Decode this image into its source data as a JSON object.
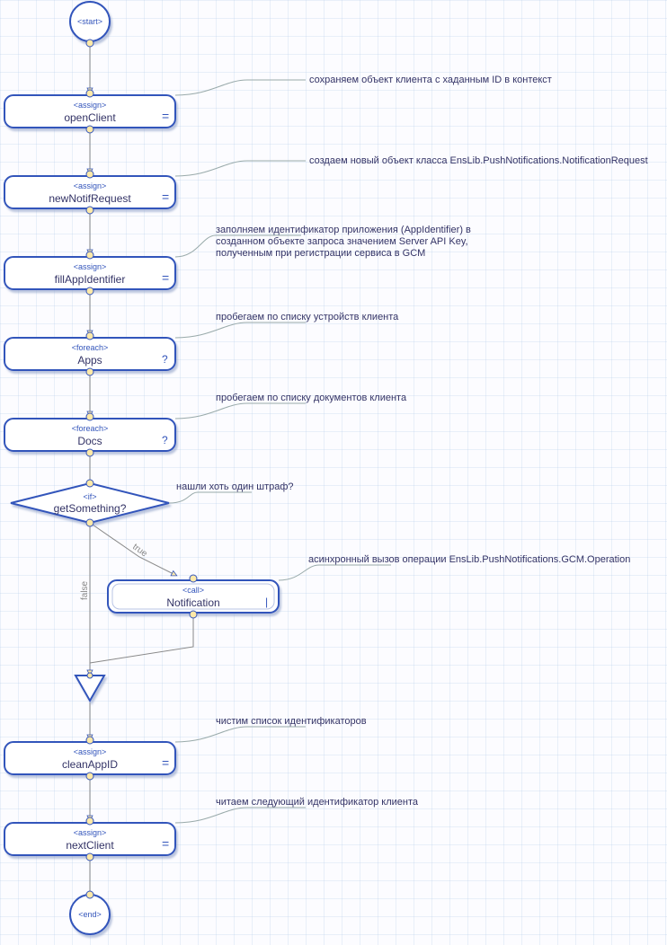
{
  "start": {
    "tag": "<start>"
  },
  "end": {
    "tag": "<end>"
  },
  "nodes": {
    "openClient": {
      "tag": "<assign>",
      "name": "openClient",
      "glyph": "=",
      "comment": "сохраняем объект клиента с хаданным ID в контекст"
    },
    "newNotifRequest": {
      "tag": "<assign>",
      "name": "newNotifRequest",
      "glyph": "=",
      "comment": "создаем новый объект класса EnsLib.PushNotifications.NotificationRequest"
    },
    "fillAppIdentifier": {
      "tag": "<assign>",
      "name": "fillAppIdentifier",
      "glyph": "=",
      "comment_line1": "заполняем идентификатор приложения (AppIdentifier) в",
      "comment_line2": "созданном объекте запроса значением Server API Key,",
      "comment_line3": "полученным при регистрации сервиса в GCM"
    },
    "apps": {
      "tag": "<foreach>",
      "name": "Apps",
      "glyph": "?",
      "comment": "пробегаем по списку устройств клиента"
    },
    "docs": {
      "tag": "<foreach>",
      "name": "Docs",
      "glyph": "?",
      "comment": "пробегаем по списку документов клиента"
    },
    "getSomething": {
      "tag": "<if>",
      "name": "getSomething?",
      "comment": "нашли хоть один штраф?"
    },
    "notification": {
      "tag": "<call>",
      "name": "Notification",
      "glyph": "|",
      "comment": "асинхронный вызов операции EnsLib.PushNotifications.GCM.Operation"
    },
    "cleanAppID": {
      "tag": "<assign>",
      "name": "cleanAppID",
      "glyph": "=",
      "comment": "чистим список идентификаторов"
    },
    "nextClient": {
      "tag": "<assign>",
      "name": "nextClient",
      "glyph": "=",
      "comment": "читаем следующий идентификатор клиента"
    }
  },
  "branches": {
    "true": "true",
    "false": "false"
  },
  "colors": {
    "stroke": "#3355bb",
    "fill": "#ffffff",
    "portFill": "#ffe9a8",
    "shadow": "#b9c5e0"
  }
}
